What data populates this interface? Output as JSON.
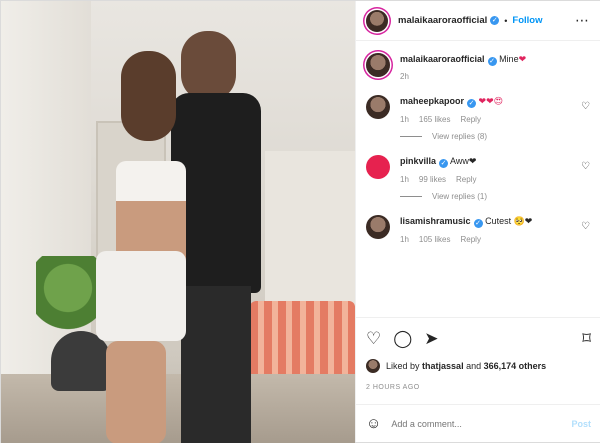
{
  "post": {
    "username": "malaikaaroraofficial",
    "follow_label": "Follow",
    "more_icon": "ellipsis-icon",
    "caption_user": "malaikaaroraofficial",
    "caption_text": "Mine",
    "caption_emoji": "❤",
    "caption_time": "2h"
  },
  "comments": [
    {
      "user": "maheepkapoor",
      "text": "❤❤😍",
      "time": "1h",
      "likes": "165 likes",
      "reply": "Reply",
      "view_replies": "View replies (8)"
    },
    {
      "user": "pinkvilla",
      "text": "Aww❤",
      "time": "1h",
      "likes": "99 likes",
      "reply": "Reply",
      "view_replies": "View replies (1)"
    },
    {
      "user": "lisamishramusic",
      "text": "Cutest 🥺❤",
      "time": "1h",
      "likes": "105 likes",
      "reply": "Reply"
    }
  ],
  "likes": {
    "prefix": "Liked by",
    "user": "thatjassal",
    "middle": "and",
    "count": "366,174 others"
  },
  "timestamp": "2 HOURS AGO",
  "add_comment": {
    "placeholder": "Add a comment...",
    "post_label": "Post"
  },
  "colors": {
    "accent": "#0095f6",
    "verified": "#3897f0",
    "muted": "#8e8e8e"
  }
}
